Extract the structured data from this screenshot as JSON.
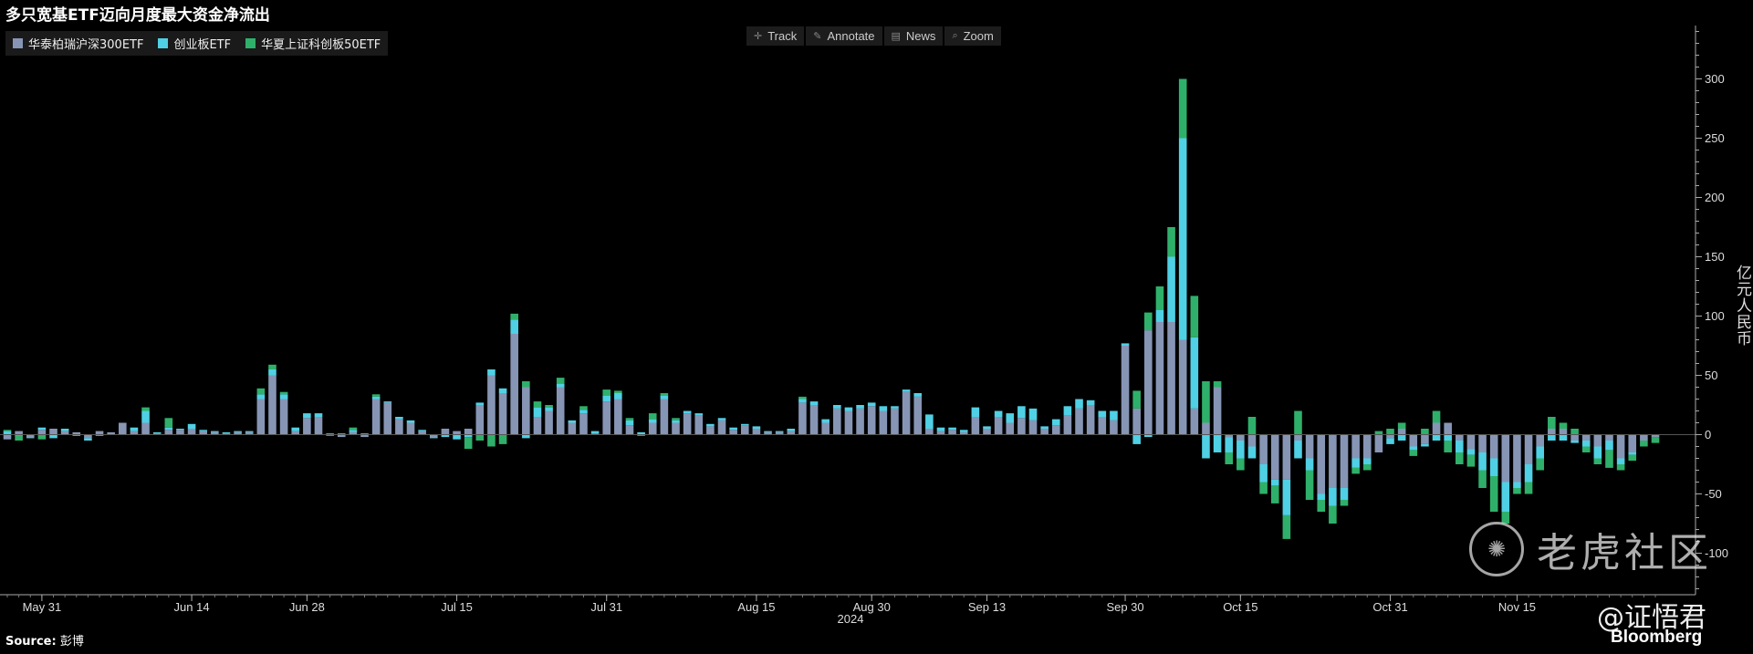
{
  "chart_data": {
    "type": "bar",
    "stacked": true,
    "title": "多只宽基ETF迈向月度最大资金净流出",
    "ylabel": "亿元人民币",
    "ylim": [
      -135,
      345
    ],
    "yticks": [
      300,
      250,
      200,
      150,
      100,
      50,
      0,
      -50,
      -100
    ],
    "year_label": "2024",
    "xlabels": [
      "May 31",
      "Jun 14",
      "Jun 28",
      "Jul 15",
      "Jul 31",
      "Aug 15",
      "Aug 30",
      "Sep 13",
      "Sep 30",
      "Oct 15",
      "Oct 31",
      "Nov 15"
    ],
    "xlabel_index": [
      3,
      16,
      26,
      39,
      52,
      65,
      75,
      85,
      97,
      107,
      120,
      131
    ],
    "legend_position": "top-left",
    "grid": false,
    "series": [
      {
        "name": "华泰柏瑞沪深300ETF",
        "color": "#8795b5",
        "values": [
          -4,
          3,
          -2,
          4,
          5,
          3,
          2,
          -3,
          3,
          2,
          10,
          3,
          10,
          1,
          4,
          4,
          5,
          3,
          2,
          1,
          2,
          2,
          30,
          50,
          30,
          3,
          14,
          15,
          -1,
          -2,
          2,
          -2,
          30,
          27,
          13,
          10,
          3,
          -2,
          5,
          3,
          5,
          25,
          50,
          35,
          85,
          40,
          15,
          20,
          40,
          10,
          18,
          1,
          28,
          30,
          8,
          -1,
          10,
          30,
          10,
          18,
          16,
          7,
          12,
          4,
          8,
          5,
          2,
          2,
          3,
          27,
          25,
          10,
          22,
          20,
          22,
          24,
          20,
          22,
          36,
          32,
          5,
          3,
          4,
          2,
          15,
          5,
          15,
          10,
          14,
          12,
          5,
          8,
          16,
          22,
          25,
          15,
          12,
          75,
          22,
          88,
          95,
          95,
          80,
          22,
          10,
          40,
          -2,
          -5,
          -10,
          -25,
          -38,
          -38,
          -5,
          -20,
          -50,
          -45,
          -45,
          -20,
          -20,
          -15,
          -3,
          5,
          -10,
          -8,
          10,
          10,
          -5,
          -12,
          -15,
          -20,
          -40,
          -40,
          -25,
          -10,
          5,
          5,
          -5,
          -5,
          -10,
          -5,
          -20,
          -15,
          -5,
          -2
        ]
      },
      {
        "name": "创业板ETF",
        "color": "#4fd0e4",
        "values": [
          3,
          -1,
          -1,
          2,
          -3,
          2,
          -1,
          -2,
          -1,
          0,
          0,
          3,
          10,
          1,
          2,
          1,
          4,
          1,
          1,
          1,
          1,
          1,
          4,
          5,
          4,
          3,
          4,
          3,
          1,
          1,
          2,
          1,
          2,
          1,
          2,
          2,
          1,
          -1,
          -2,
          -4,
          -2,
          2,
          5,
          4,
          12,
          -3,
          8,
          3,
          3,
          2,
          3,
          2,
          5,
          5,
          4,
          2,
          3,
          3,
          2,
          2,
          2,
          2,
          2,
          2,
          1,
          2,
          1,
          1,
          2,
          3,
          3,
          3,
          3,
          3,
          3,
          3,
          4,
          2,
          2,
          3,
          12,
          3,
          2,
          2,
          8,
          2,
          5,
          8,
          10,
          10,
          2,
          5,
          8,
          8,
          4,
          5,
          8,
          2,
          -8,
          -2,
          10,
          55,
          170,
          60,
          -20,
          -15,
          -13,
          -15,
          -10,
          -15,
          -5,
          -30,
          -15,
          -10,
          -5,
          -15,
          -10,
          -8,
          -5,
          0,
          -5,
          -5,
          -3,
          -2,
          -5,
          -5,
          -10,
          -5,
          -15,
          -15,
          -25,
          -5,
          -15,
          -10,
          -5,
          -5,
          -2,
          -5,
          -10,
          -8,
          -5,
          -2
        ]
      },
      {
        "name": "华夏上证科创板50ETF",
        "color": "#2fb06a",
        "values": [
          1,
          -4,
          0,
          -4,
          0,
          0,
          0,
          0,
          0,
          0,
          0,
          0,
          3,
          0,
          8,
          0,
          0,
          0,
          0,
          0,
          0,
          0,
          5,
          4,
          2,
          0,
          0,
          0,
          0,
          0,
          2,
          0,
          2,
          0,
          0,
          0,
          0,
          0,
          0,
          0,
          -10,
          -5,
          -10,
          -8,
          5,
          5,
          5,
          2,
          5,
          0,
          3,
          0,
          5,
          2,
          2,
          0,
          5,
          2,
          2,
          0,
          0,
          0,
          0,
          0,
          0,
          0,
          0,
          0,
          0,
          2,
          0,
          0,
          0,
          0,
          0,
          0,
          0,
          0,
          0,
          0,
          0,
          0,
          0,
          0,
          0,
          0,
          0,
          0,
          0,
          0,
          0,
          0,
          0,
          0,
          0,
          0,
          0,
          0,
          15,
          15,
          20,
          25,
          50,
          35,
          35,
          5,
          -10,
          -10,
          15,
          -10,
          -15,
          -20,
          20,
          -25,
          -10,
          -15,
          -5,
          -5,
          -5,
          3,
          5,
          5,
          -5,
          5,
          10,
          -10,
          -10,
          -10,
          -15,
          -30,
          -10,
          -5,
          -10,
          -10,
          10,
          5,
          5,
          -5,
          -5,
          -15,
          -5,
          -5,
          -5,
          -5
        ]
      }
    ]
  },
  "toolbar": {
    "track": "Track",
    "annotate": "Annotate",
    "news": "News",
    "zoom": "Zoom"
  },
  "footer": {
    "source_label": "Source:",
    "source_text": "彭博",
    "brand": "Bloomberg"
  },
  "watermark": {
    "text": "老虎社区",
    "author": "@证悟君"
  }
}
